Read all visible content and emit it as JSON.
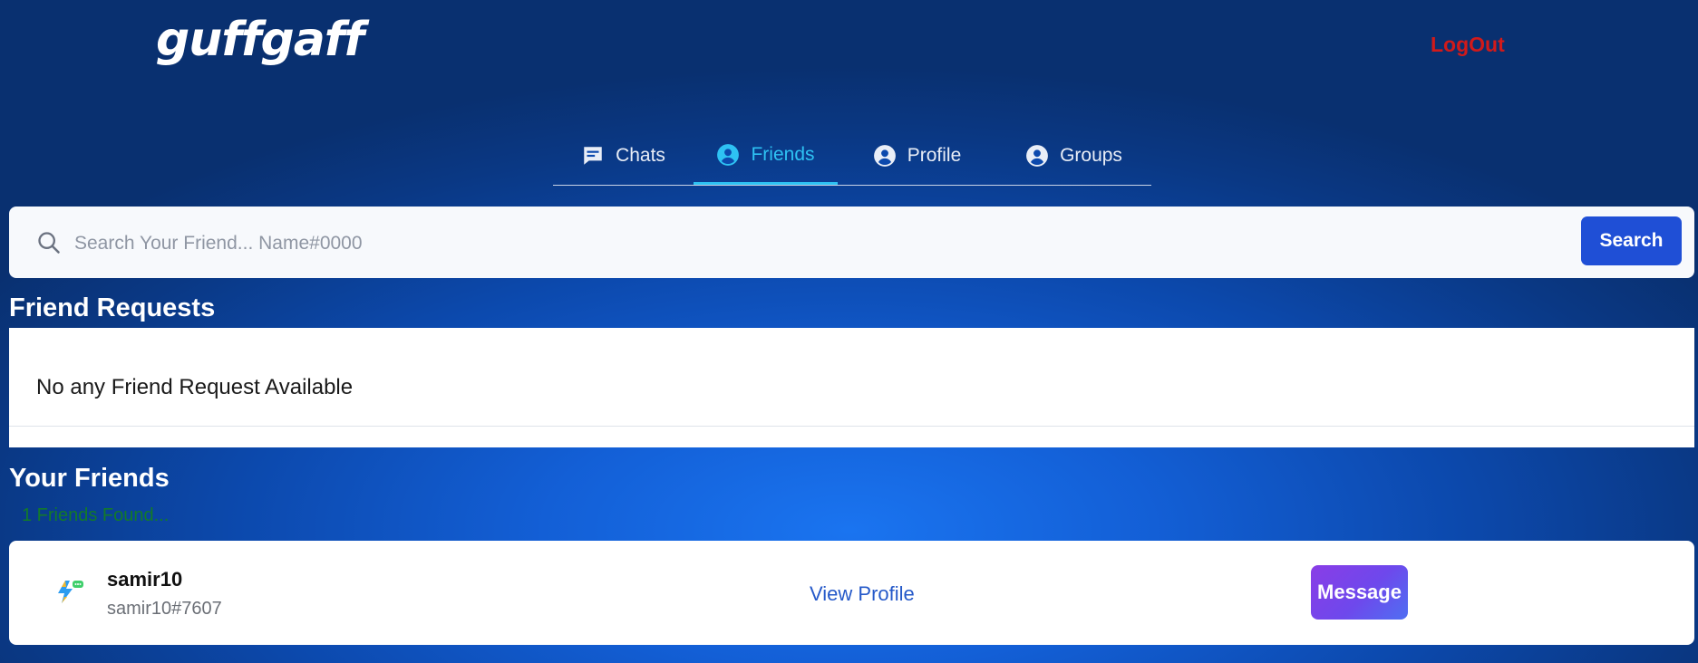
{
  "app": {
    "logo_text": "guffgaff",
    "logout_label": "LogOut"
  },
  "tabs": [
    {
      "label": "Chats",
      "icon": "chat-bubble-icon",
      "active": false
    },
    {
      "label": "Friends",
      "icon": "user-circle-icon",
      "active": true
    },
    {
      "label": "Profile",
      "icon": "user-circle-icon",
      "active": false
    },
    {
      "label": "Groups",
      "icon": "user-circle-icon",
      "active": false
    }
  ],
  "search": {
    "placeholder": "Search Your Friend... Name#0000",
    "value": "",
    "button_label": "Search",
    "icon": "search-icon"
  },
  "friend_requests": {
    "title": "Friend Requests",
    "empty_message": "No any Friend Request Available"
  },
  "friends": {
    "title": "Your Friends",
    "found_text": "1 Friends Found...",
    "list": [
      {
        "name": "samir10",
        "tag": "samir10#7607",
        "view_profile_label": "View Profile",
        "message_label": "Message",
        "avatar_icon": "app-logo-icon"
      }
    ]
  },
  "colors": {
    "accent_active_tab": "#2ec2f3",
    "logout": "#d11a1a",
    "search_button": "#1f4fd6",
    "found_text": "#137a2a",
    "view_profile_link": "#2559c9",
    "message_gradient_start": "#8a3de6",
    "message_gradient_end": "#4f6ff2"
  }
}
